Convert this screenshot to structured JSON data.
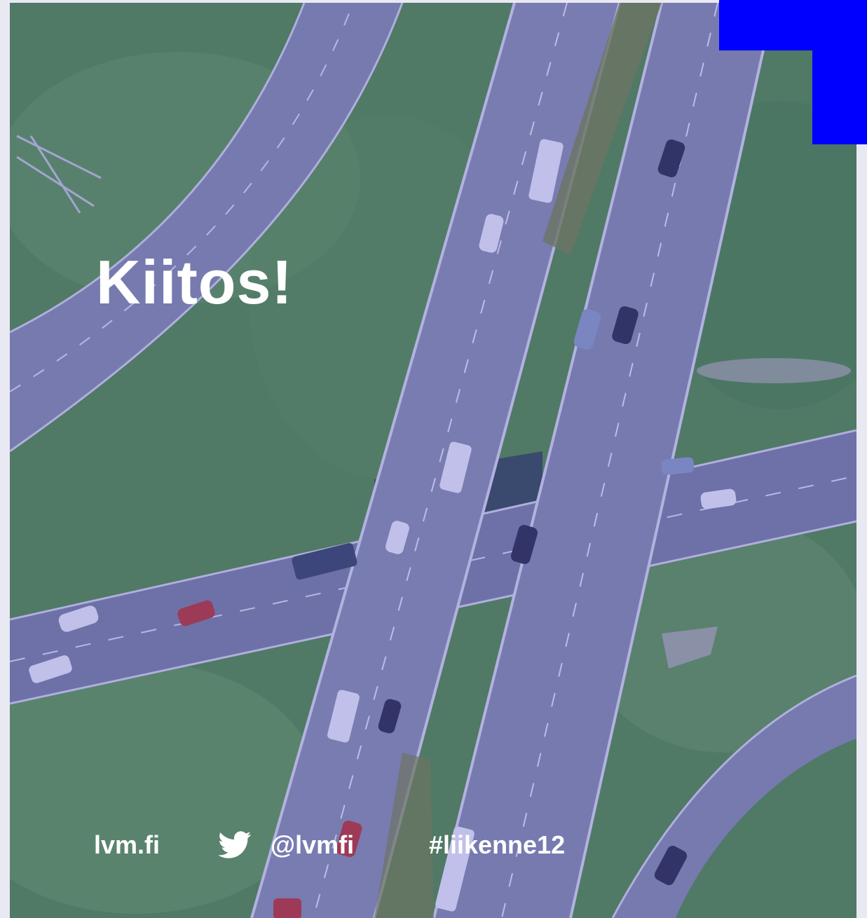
{
  "slide": {
    "title": "Kiitos!",
    "website": "lvm.fi",
    "twitter_handle": "@lvmfi",
    "hashtag": "#liikenne12",
    "icons": [
      "twitter-bird-icon"
    ],
    "colors": {
      "accent_blue": "#0000ff",
      "text": "#ffffff",
      "tint": "#463cc8"
    }
  }
}
